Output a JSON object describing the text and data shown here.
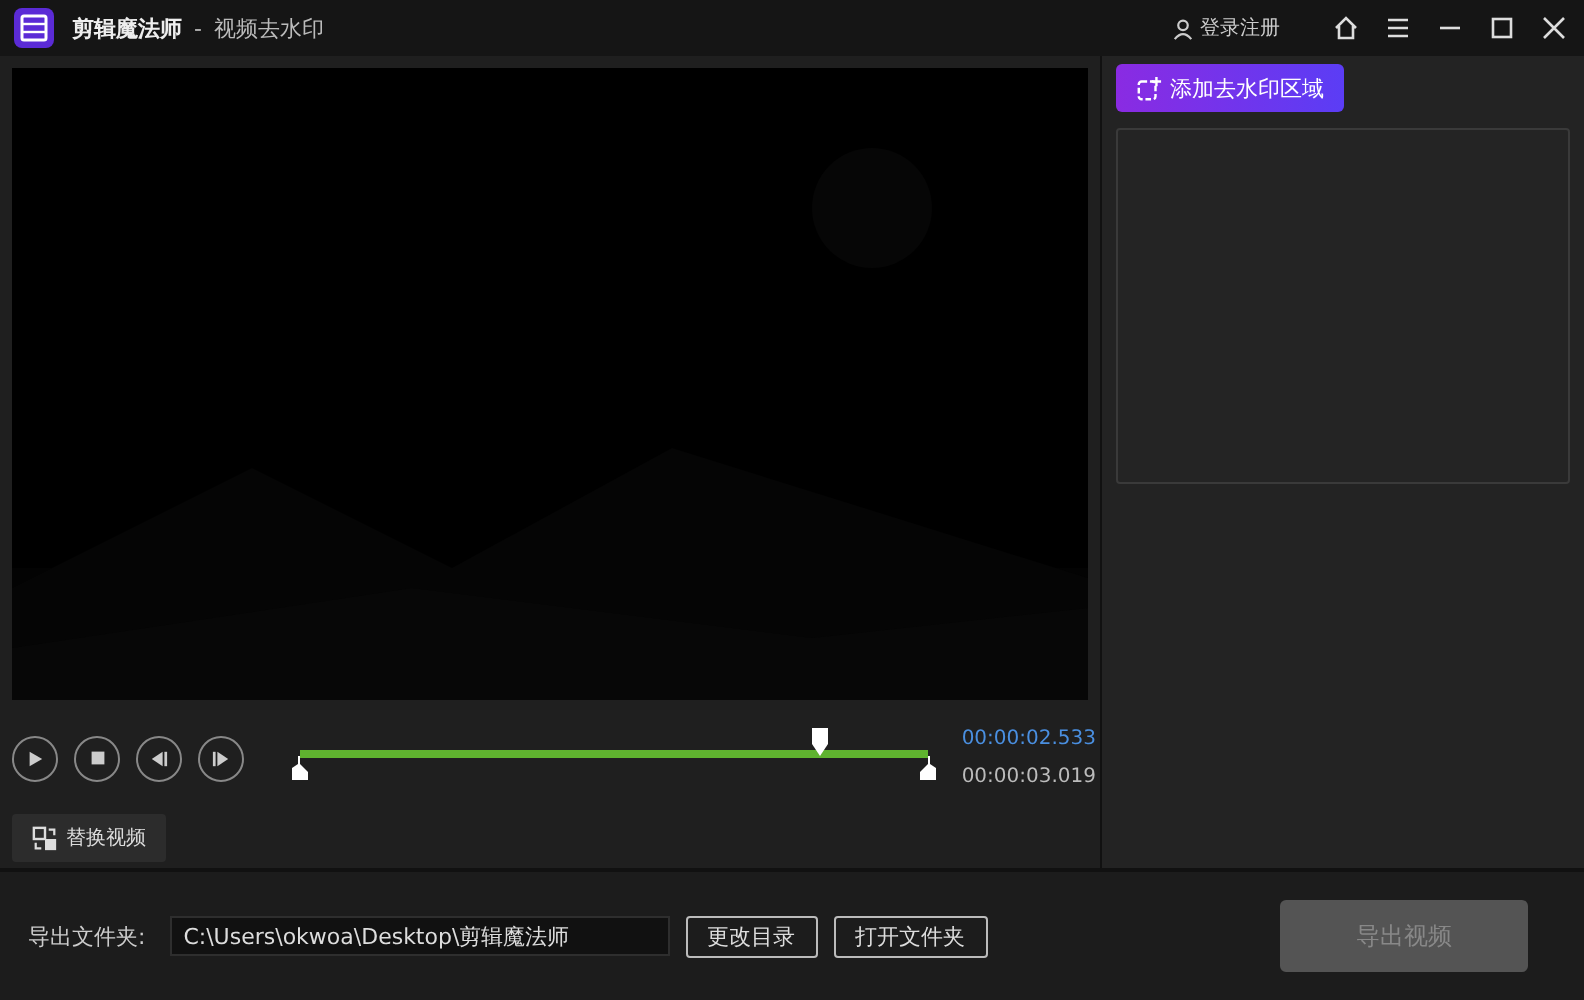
{
  "window": {
    "app_name": "剪辑魔法师",
    "separator": "-",
    "title": "视频去水印",
    "account": "登录注册"
  },
  "add_region_button": "添加去水印区域",
  "playback": {
    "level": 0.82,
    "current_time": "00:00:02.533",
    "total_time": "00:00:03.019"
  },
  "replace_button": "替换视频",
  "export": {
    "folder_label": "导出文件夹:",
    "folder_path": "C:\\Users\\okwoa\\Desktop\\剪辑魔法师",
    "change_button": "更改目录",
    "open_button": "打开文件夹",
    "export_button": "导出视频",
    "export_disabled": true
  }
}
